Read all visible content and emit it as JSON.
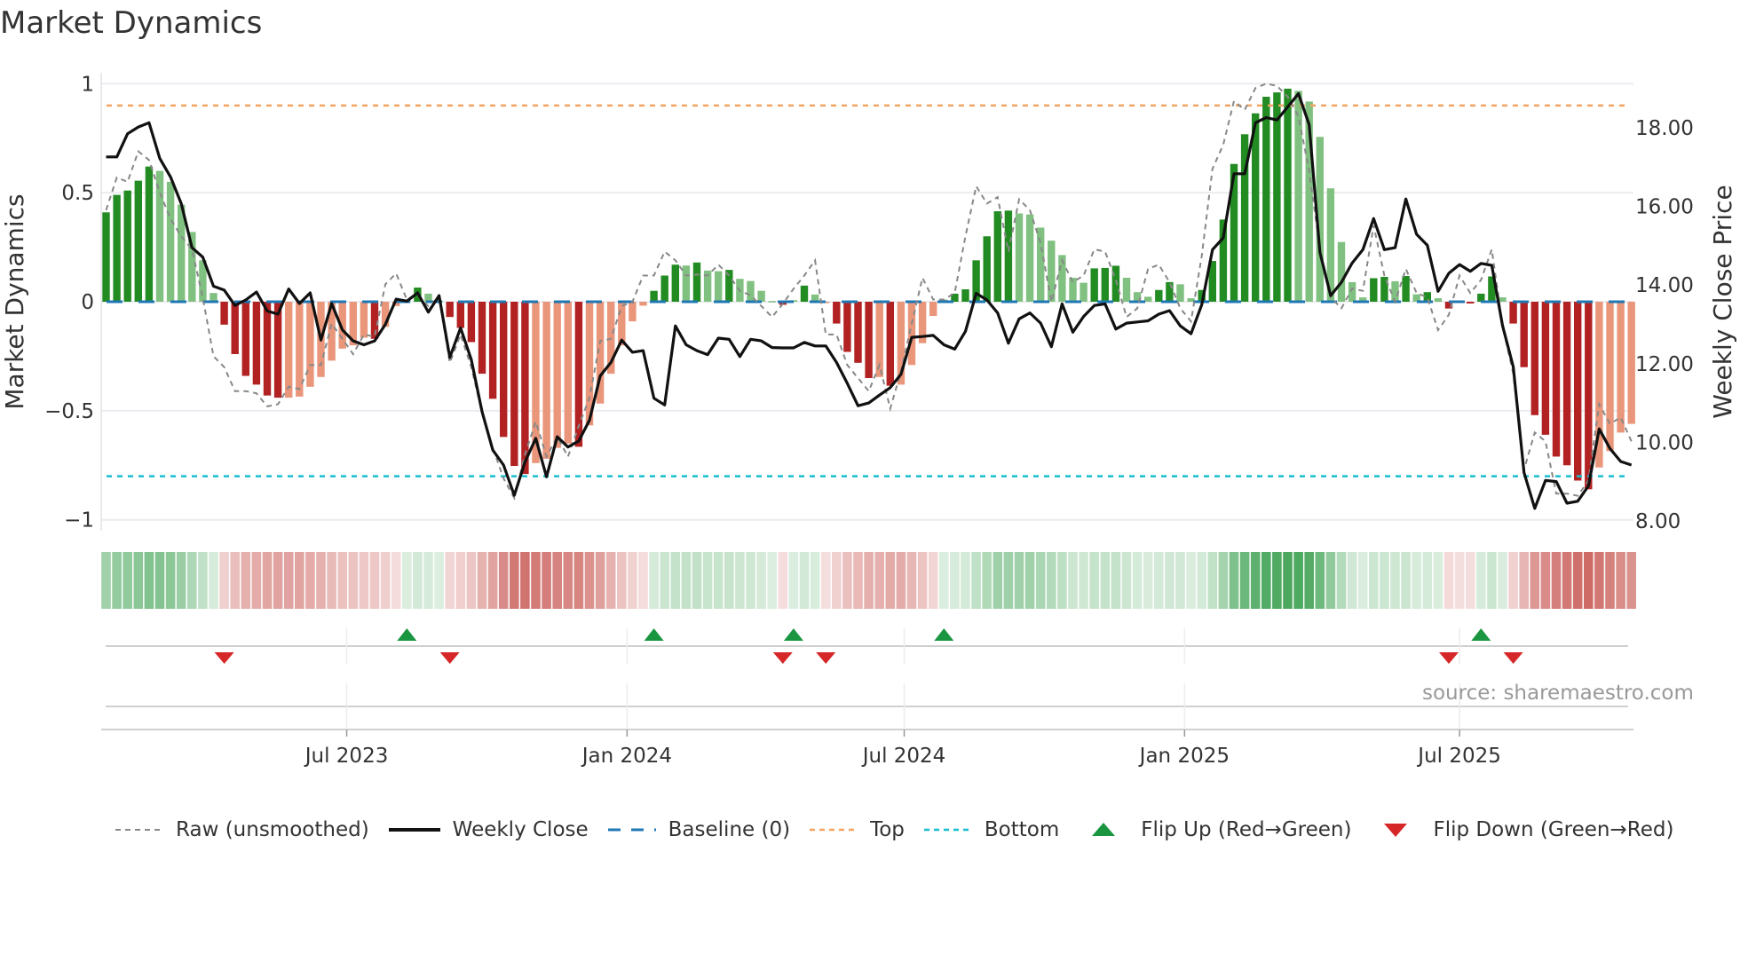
{
  "title": "Market Dynamics",
  "source": "source: sharemaestro.com",
  "legend": {
    "raw": "Raw (unsmoothed)",
    "close": "Weekly Close",
    "baseline": "Baseline (0)",
    "top": "Top",
    "bottom": "Bottom",
    "flip_up": "Flip Up (Red→Green)",
    "flip_down": "Flip Down (Green→Red)"
  },
  "colors": {
    "pos_strong": "#228b22",
    "pos_weak": "#80c080",
    "neg_strong": "#b22222",
    "neg_weak": "#e9967a",
    "baseline": "#1f77b4",
    "top": "#f4a460",
    "bottom": "#17becf",
    "flip_up": "#1a9641",
    "flip_down": "#d62728",
    "close": "#111111",
    "raw": "#888888"
  },
  "chart_data": {
    "type": "bar+line",
    "title": "Market Dynamics",
    "ylabel": "Market Dynamics",
    "y2label": "Weekly Close Price",
    "ylim": [
      -1.05,
      1.05
    ],
    "y2lim": [
      7.75,
      19.4
    ],
    "yticks": [
      {
        "v": 1,
        "label": "1"
      },
      {
        "v": 0.5,
        "label": "0.5"
      },
      {
        "v": 0,
        "label": "0"
      },
      {
        "v": -0.5,
        "label": "−0.5"
      },
      {
        "v": -1,
        "label": "−1"
      }
    ],
    "y2ticks": [
      {
        "v": 18,
        "label": "18.00"
      },
      {
        "v": 16,
        "label": "16.00"
      },
      {
        "v": 14,
        "label": "14.00"
      },
      {
        "v": 12,
        "label": "12.00"
      },
      {
        "v": 10,
        "label": "10.00"
      },
      {
        "v": 8,
        "label": "8.00"
      }
    ],
    "x_unit": "week index",
    "xticks": [
      {
        "x": 22.4,
        "label": "Jul 2023"
      },
      {
        "x": 48.5,
        "label": "Jan 2024"
      },
      {
        "x": 74.3,
        "label": "Jul 2024"
      },
      {
        "x": 100.4,
        "label": "Jan 2025"
      },
      {
        "x": 126.0,
        "label": "Jul 2025"
      }
    ],
    "top_level": 0.9,
    "bottom_level": -0.8,
    "baseline": 0,
    "smoothed": [
      0.41,
      0.49,
      0.51,
      0.555,
      0.62,
      0.6,
      0.55,
      0.445,
      0.32,
      0.19,
      0.04,
      -0.105,
      -0.24,
      -0.34,
      -0.38,
      -0.43,
      -0.44,
      -0.44,
      -0.435,
      -0.39,
      -0.345,
      -0.27,
      -0.215,
      -0.2,
      -0.165,
      -0.17,
      -0.115,
      -0.02,
      0.01,
      0.065,
      0.037,
      0.005,
      -0.07,
      -0.12,
      -0.185,
      -0.33,
      -0.445,
      -0.62,
      -0.753,
      -0.79,
      -0.74,
      -0.72,
      -0.67,
      -0.65,
      -0.665,
      -0.567,
      -0.467,
      -0.33,
      -0.2,
      -0.09,
      -0.018,
      0.05,
      0.12,
      0.17,
      0.166,
      0.18,
      0.143,
      0.14,
      0.146,
      0.105,
      0.095,
      0.05,
      0.003,
      -0.014,
      0.007,
      0.074,
      0.033,
      -0.005,
      -0.1,
      -0.23,
      -0.28,
      -0.35,
      -0.345,
      -0.385,
      -0.38,
      -0.29,
      -0.19,
      -0.065,
      0.01,
      0.037,
      0.057,
      0.19,
      0.3,
      0.415,
      0.418,
      0.405,
      0.4,
      0.34,
      0.28,
      0.214,
      0.11,
      0.087,
      0.153,
      0.155,
      0.165,
      0.11,
      0.044,
      0.023,
      0.054,
      0.09,
      0.08,
      0.016,
      0.054,
      0.187,
      0.377,
      0.632,
      0.768,
      0.864,
      0.94,
      0.96,
      0.977,
      0.967,
      0.918,
      0.756,
      0.52,
      0.274,
      0.09,
      0.02,
      0.108,
      0.114,
      0.094,
      0.118,
      0.034,
      0.044,
      0.016,
      -0.031,
      -0.002,
      -0.008,
      0.037,
      0.116,
      0.02,
      -0.1,
      -0.3,
      -0.52,
      -0.61,
      -0.71,
      -0.75,
      -0.82,
      -0.86,
      -0.76,
      -0.685,
      -0.6,
      -0.56
    ],
    "raw": [
      0.42,
      0.57,
      0.55,
      0.69,
      0.65,
      0.5,
      0.38,
      0.3,
      0.24,
      0.02,
      -0.25,
      -0.3,
      -0.41,
      -0.41,
      -0.42,
      -0.48,
      -0.47,
      -0.39,
      -0.4,
      -0.29,
      -0.29,
      -0.1,
      -0.17,
      -0.24,
      -0.15,
      -0.16,
      0.08,
      0.13,
      0.01,
      0.03,
      -0.02,
      0.02,
      -0.28,
      -0.15,
      -0.3,
      -0.51,
      -0.67,
      -0.81,
      -0.9,
      -0.7,
      -0.55,
      -0.71,
      -0.62,
      -0.71,
      -0.57,
      -0.44,
      -0.18,
      -0.17,
      -0.02,
      0,
      0.12,
      0.12,
      0.23,
      0.19,
      0.12,
      0.125,
      0.12,
      0.17,
      0.12,
      0.05,
      0.03,
      -0.02,
      -0.07,
      -0.01,
      0.06,
      0.12,
      0.19,
      -0.15,
      -0.15,
      -0.29,
      -0.35,
      -0.41,
      -0.29,
      -0.49,
      -0.32,
      -0.1,
      0.11,
      0.01,
      0.01,
      0.04,
      0.3,
      0.53,
      0.45,
      0.48,
      0.23,
      0.47,
      0.42,
      0.27,
      0,
      0.19,
      0.09,
      0.12,
      0.24,
      0.23,
      0.1,
      -0.07,
      -0.03,
      0.15,
      0.17,
      0.09,
      -0.03,
      -0.09,
      0.21,
      0.61,
      0.72,
      0.92,
      0.88,
      0.98,
      1.0,
      0.99,
      0.94,
      0.85,
      0.6,
      0.24,
      0.02,
      -0.03,
      0.06,
      0.05,
      0.35,
      0.12,
      0,
      0.15,
      0.04,
      0.02,
      -0.13,
      -0.06,
      0.12,
      0.04,
      0.1,
      0.24,
      -0.11,
      -0.33,
      -0.77,
      -0.6,
      -0.64,
      -0.88,
      -0.88,
      -0.89,
      -0.82,
      -0.47,
      -0.56,
      -0.53,
      -0.64
    ],
    "close": [
      17.26,
      17.26,
      17.85,
      18.02,
      18.13,
      17.22,
      16.75,
      16.07,
      14.95,
      14.71,
      13.97,
      13.87,
      13.48,
      13.62,
      13.82,
      13.34,
      13.26,
      13.9,
      13.53,
      13.8,
      12.6,
      13.53,
      12.86,
      12.58,
      12.48,
      12.58,
      13.0,
      13.64,
      13.59,
      13.8,
      13.31,
      13.73,
      12.16,
      12.91,
      12.1,
      10.78,
      9.8,
      9.42,
      8.65,
      9.5,
      10.1,
      9.12,
      10.14,
      9.88,
      10.03,
      10.56,
      11.69,
      12.03,
      12.6,
      12.29,
      12.33,
      11.12,
      10.95,
      12.96,
      12.48,
      12.33,
      12.23,
      12.65,
      12.62,
      12.18,
      12.62,
      12.58,
      12.41,
      12.4,
      12.4,
      12.54,
      12.45,
      12.45,
      12.03,
      11.5,
      10.93,
      11.0,
      11.2,
      11.39,
      11.73,
      12.67,
      12.69,
      12.72,
      12.48,
      12.37,
      12.82,
      13.79,
      13.62,
      13.29,
      12.52,
      13.14,
      13.29,
      13.03,
      12.43,
      13.52,
      12.8,
      13.2,
      13.48,
      13.52,
      12.88,
      13.03,
      13.06,
      13.09,
      13.26,
      13.35,
      12.96,
      12.76,
      13.5,
      14.9,
      15.2,
      16.83,
      16.83,
      18.13,
      18.26,
      18.2,
      18.53,
      18.87,
      18.08,
      14.83,
      13.73,
      14.07,
      14.56,
      14.9,
      15.69,
      14.9,
      14.95,
      16.19,
      15.29,
      15.01,
      13.84,
      14.3,
      14.52,
      14.35,
      14.55,
      14.5,
      12.97,
      11.92,
      9.23,
      8.32,
      9.03,
      9.0,
      8.45,
      8.5,
      8.89,
      10.34,
      9.84,
      9.51,
      9.42
    ],
    "flip_up": [
      28,
      51,
      64,
      78,
      128
    ],
    "flip_down": [
      11,
      32,
      63,
      67,
      125,
      131
    ],
    "legend_position": "bottom"
  }
}
